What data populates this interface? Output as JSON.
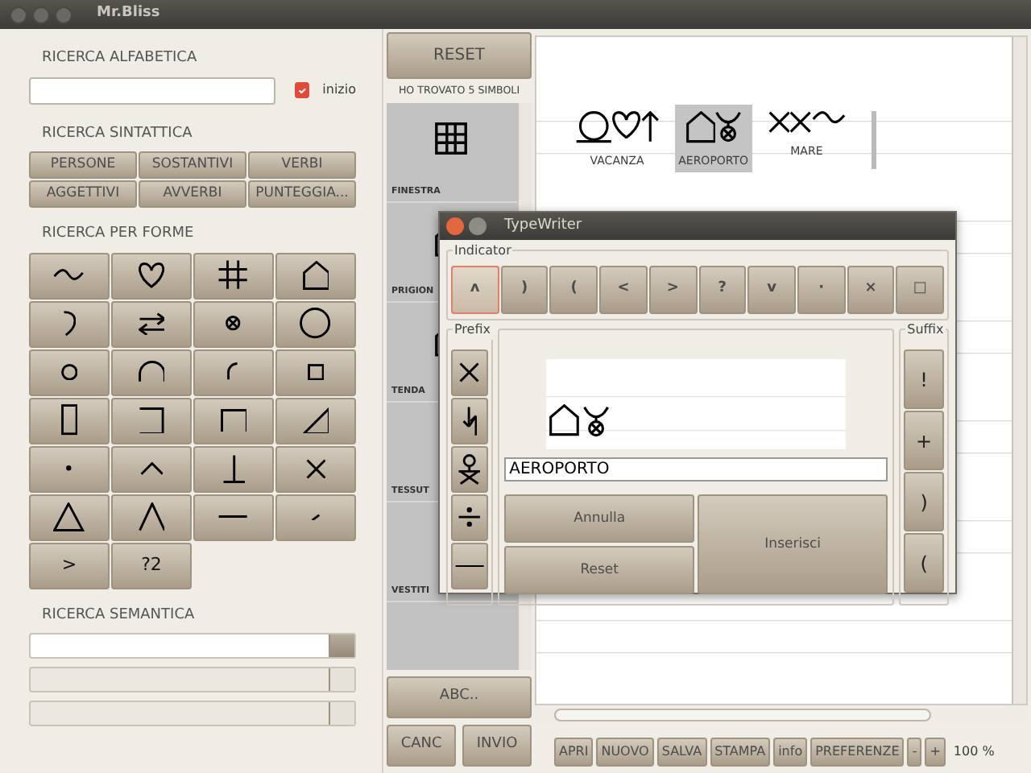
{
  "window": {
    "title": "Mr.Bliss"
  },
  "alphabetic_search": {
    "heading": "RICERCA ALFABETICA",
    "checkbox": {
      "label": "inizio",
      "checked": true
    }
  },
  "syntactic_search": {
    "heading": "RICERCA SINTATTICA",
    "buttons": [
      "PERSONE",
      "SOSTANTIVI",
      "VERBI",
      "AGGETTIVI",
      "AVVERBI",
      "PUNTEGGIA..."
    ]
  },
  "shape_search": {
    "heading": "RICERCA PER FORME",
    "shapes": [
      {
        "kind": "wave"
      },
      {
        "kind": "heart"
      },
      {
        "kind": "hash"
      },
      {
        "kind": "house"
      },
      {
        "kind": "hook"
      },
      {
        "kind": "exchange"
      },
      {
        "kind": "circle-x"
      },
      {
        "kind": "circle"
      },
      {
        "kind": "small-circle"
      },
      {
        "kind": "arch"
      },
      {
        "kind": "quarter-arc"
      },
      {
        "kind": "small-square"
      },
      {
        "kind": "rect-tall"
      },
      {
        "kind": "bracket-right"
      },
      {
        "kind": "bracket-top"
      },
      {
        "kind": "right-triangle"
      },
      {
        "kind": "dot"
      },
      {
        "kind": "caret"
      },
      {
        "kind": "perp"
      },
      {
        "kind": "cross"
      },
      {
        "kind": "triangle"
      },
      {
        "kind": "lambda"
      },
      {
        "kind": "dash"
      },
      {
        "kind": "tick"
      },
      {
        "kind": "text",
        "label": ">"
      },
      {
        "kind": "text",
        "label": "?2"
      }
    ]
  },
  "semantic_search": {
    "heading": "RICERCA SEMANTICA",
    "selects": [
      {
        "disabled": false
      },
      {
        "disabled": true
      },
      {
        "disabled": true
      }
    ]
  },
  "results": {
    "reset": "RESET",
    "count": "HO TROVATO 5 SIMBOLI",
    "items": [
      {
        "label": "FINESTRA",
        "kind": "window"
      },
      {
        "label": "PRIGION",
        "kind": "house"
      },
      {
        "label": "TENDA",
        "kind": "house"
      },
      {
        "label": "TESSUT",
        "kind": "hidden"
      },
      {
        "label": "VESTITI",
        "kind": "hidden"
      }
    ],
    "abc": "ABC..",
    "buttons": [
      "CANC",
      "INVIO"
    ]
  },
  "sentence": {
    "words": [
      {
        "label": "VACANZA",
        "selected": false,
        "glyphs": [
          {
            "kind": "ground-circle"
          },
          {
            "kind": "heart"
          },
          {
            "kind": "arrow-up"
          }
        ]
      },
      {
        "label": "AEROPORTO",
        "selected": true,
        "glyphs": [
          {
            "kind": "house"
          },
          {
            "kind": "plane"
          }
        ]
      },
      {
        "label": "MARE",
        "selected": false,
        "glyphs": [
          {
            "kind": "cross"
          },
          {
            "kind": "cross"
          },
          {
            "kind": "wave"
          }
        ]
      }
    ]
  },
  "toolbar": {
    "buttons": [
      "APRI",
      "NUOVO",
      "SALVA",
      "STAMPA",
      "info",
      "PREFERENZE",
      "-",
      "+"
    ],
    "zoom": "100 %"
  },
  "dialog": {
    "title": "TypeWriter",
    "indicator": {
      "legend": "Indicator",
      "buttons": [
        {
          "label": "ʌ",
          "selected": true
        },
        {
          "label": ")",
          "selected": false
        },
        {
          "label": "(",
          "selected": false
        },
        {
          "label": "<",
          "selected": false
        },
        {
          "label": ">",
          "selected": false
        },
        {
          "label": "?",
          "selected": false
        },
        {
          "label": "v",
          "selected": false
        },
        {
          "label": "·",
          "selected": false
        },
        {
          "label": "×",
          "selected": false
        },
        {
          "label": "□",
          "selected": false
        }
      ]
    },
    "prefix": {
      "legend": "Prefix",
      "buttons": [
        {
          "kind": "cross"
        },
        {
          "kind": "updown"
        },
        {
          "kind": "person"
        },
        {
          "kind": "divide"
        },
        {
          "kind": "dash"
        }
      ]
    },
    "preview": {
      "glyphs": [
        {
          "kind": "house"
        },
        {
          "kind": "plane"
        }
      ]
    },
    "name": "AEROPORTO",
    "cancel": "Annulla",
    "reset": "Reset",
    "insert": "Inserisci",
    "suffix": {
      "legend": "Suffix",
      "buttons": [
        "!",
        "+",
        ")",
        "("
      ]
    }
  }
}
